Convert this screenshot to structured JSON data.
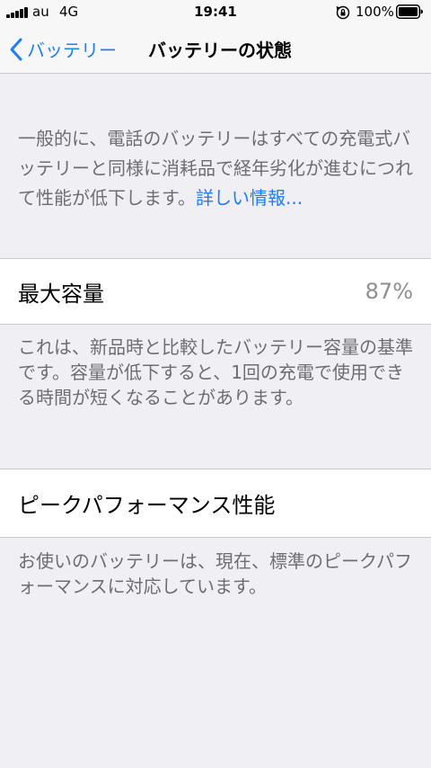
{
  "status_bar": {
    "carrier": "au",
    "network": "4G",
    "time": "19:41",
    "battery_percent": "100%"
  },
  "nav": {
    "back_label": "バッテリー",
    "title": "バッテリーの状態"
  },
  "intro": {
    "text": "一般的に、電話のバッテリーはすべての充電式バッテリーと同様に消耗品で経年劣化が進むにつれて性能が低下します。",
    "link": "詳しい情報..."
  },
  "max_capacity": {
    "label": "最大容量",
    "value": "87%",
    "description": "これは、新品時と比較したバッテリー容量の基準です。容量が低下すると、1回の充電で使用できる時間が短くなることがあります。"
  },
  "peak_performance": {
    "label": "ピークパフォーマンス性能",
    "description": "お使いのバッテリーは、現在、標準のピークパフォーマンスに対応しています。"
  }
}
